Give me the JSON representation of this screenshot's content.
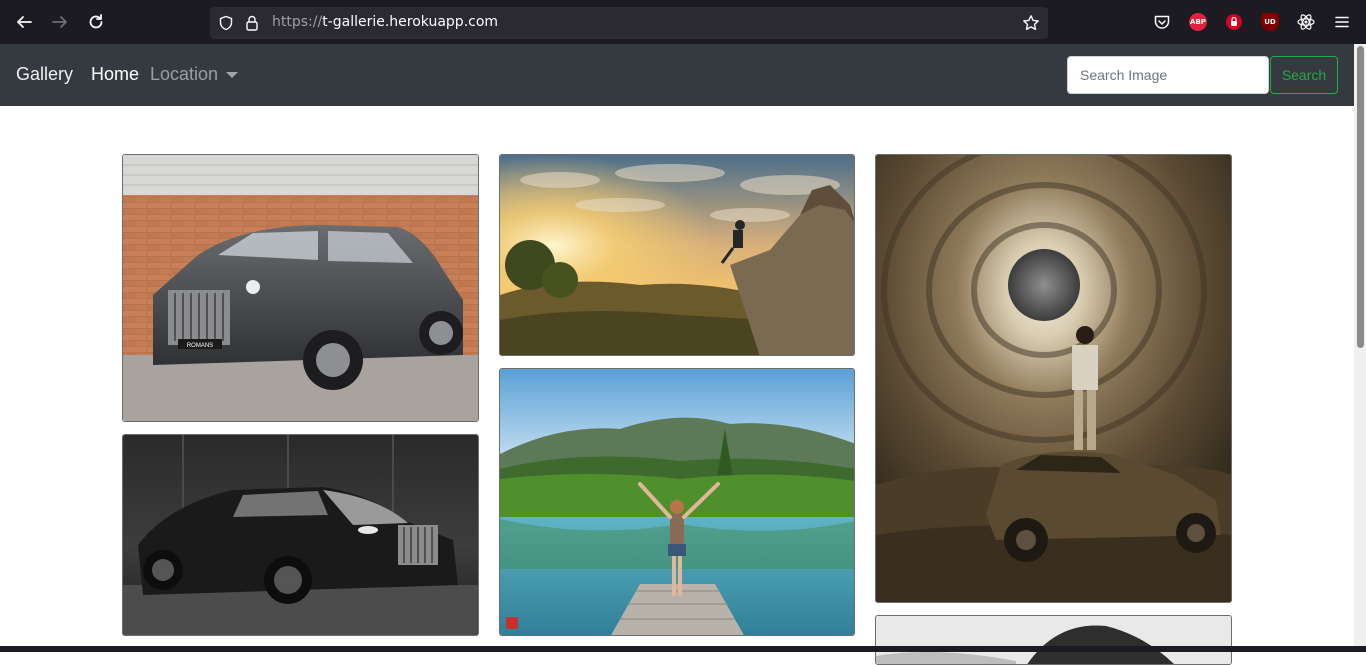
{
  "browser": {
    "url_scheme": "https://",
    "url_host": "t-gallerie.herokuapp.com",
    "extensions": [
      {
        "name": "pocket-icon"
      },
      {
        "name": "adblock-plus-icon",
        "label": "ABP",
        "color": "#e2203b"
      },
      {
        "name": "password-lock-icon",
        "color": "#d70022"
      },
      {
        "name": "ublock-origin-icon",
        "label": "UD",
        "color": "#800000"
      },
      {
        "name": "react-devtools-icon"
      },
      {
        "name": "menu-icon"
      }
    ]
  },
  "navbar": {
    "brand": "Gallery",
    "home": "Home",
    "location": "Location",
    "search_placeholder": "Search Image",
    "search_button": "Search",
    "accent_color": "#28a745",
    "background": "#343a40"
  },
  "gallery": {
    "images": [
      {
        "name": "gallery-image-rolls-royce-cullinan",
        "subject": "Grey Rolls-Royce SUV in front of brick wall",
        "plate_text": "ROMANS"
      },
      {
        "name": "gallery-image-rolls-royce-wraith",
        "subject": "Black Rolls-Royce coupe in dark studio"
      },
      {
        "name": "gallery-image-cliff-sunset",
        "subject": "Person sitting on cliff edge at sunset"
      },
      {
        "name": "gallery-image-lake-jetty",
        "subject": "Woman with raised arms on jetty by mountain lake"
      },
      {
        "name": "gallery-image-moon-vortex",
        "subject": "Man standing on old car under moon vortex"
      },
      {
        "name": "gallery-image-bw-partial",
        "subject": "Black and white photo, partially visible"
      }
    ]
  }
}
